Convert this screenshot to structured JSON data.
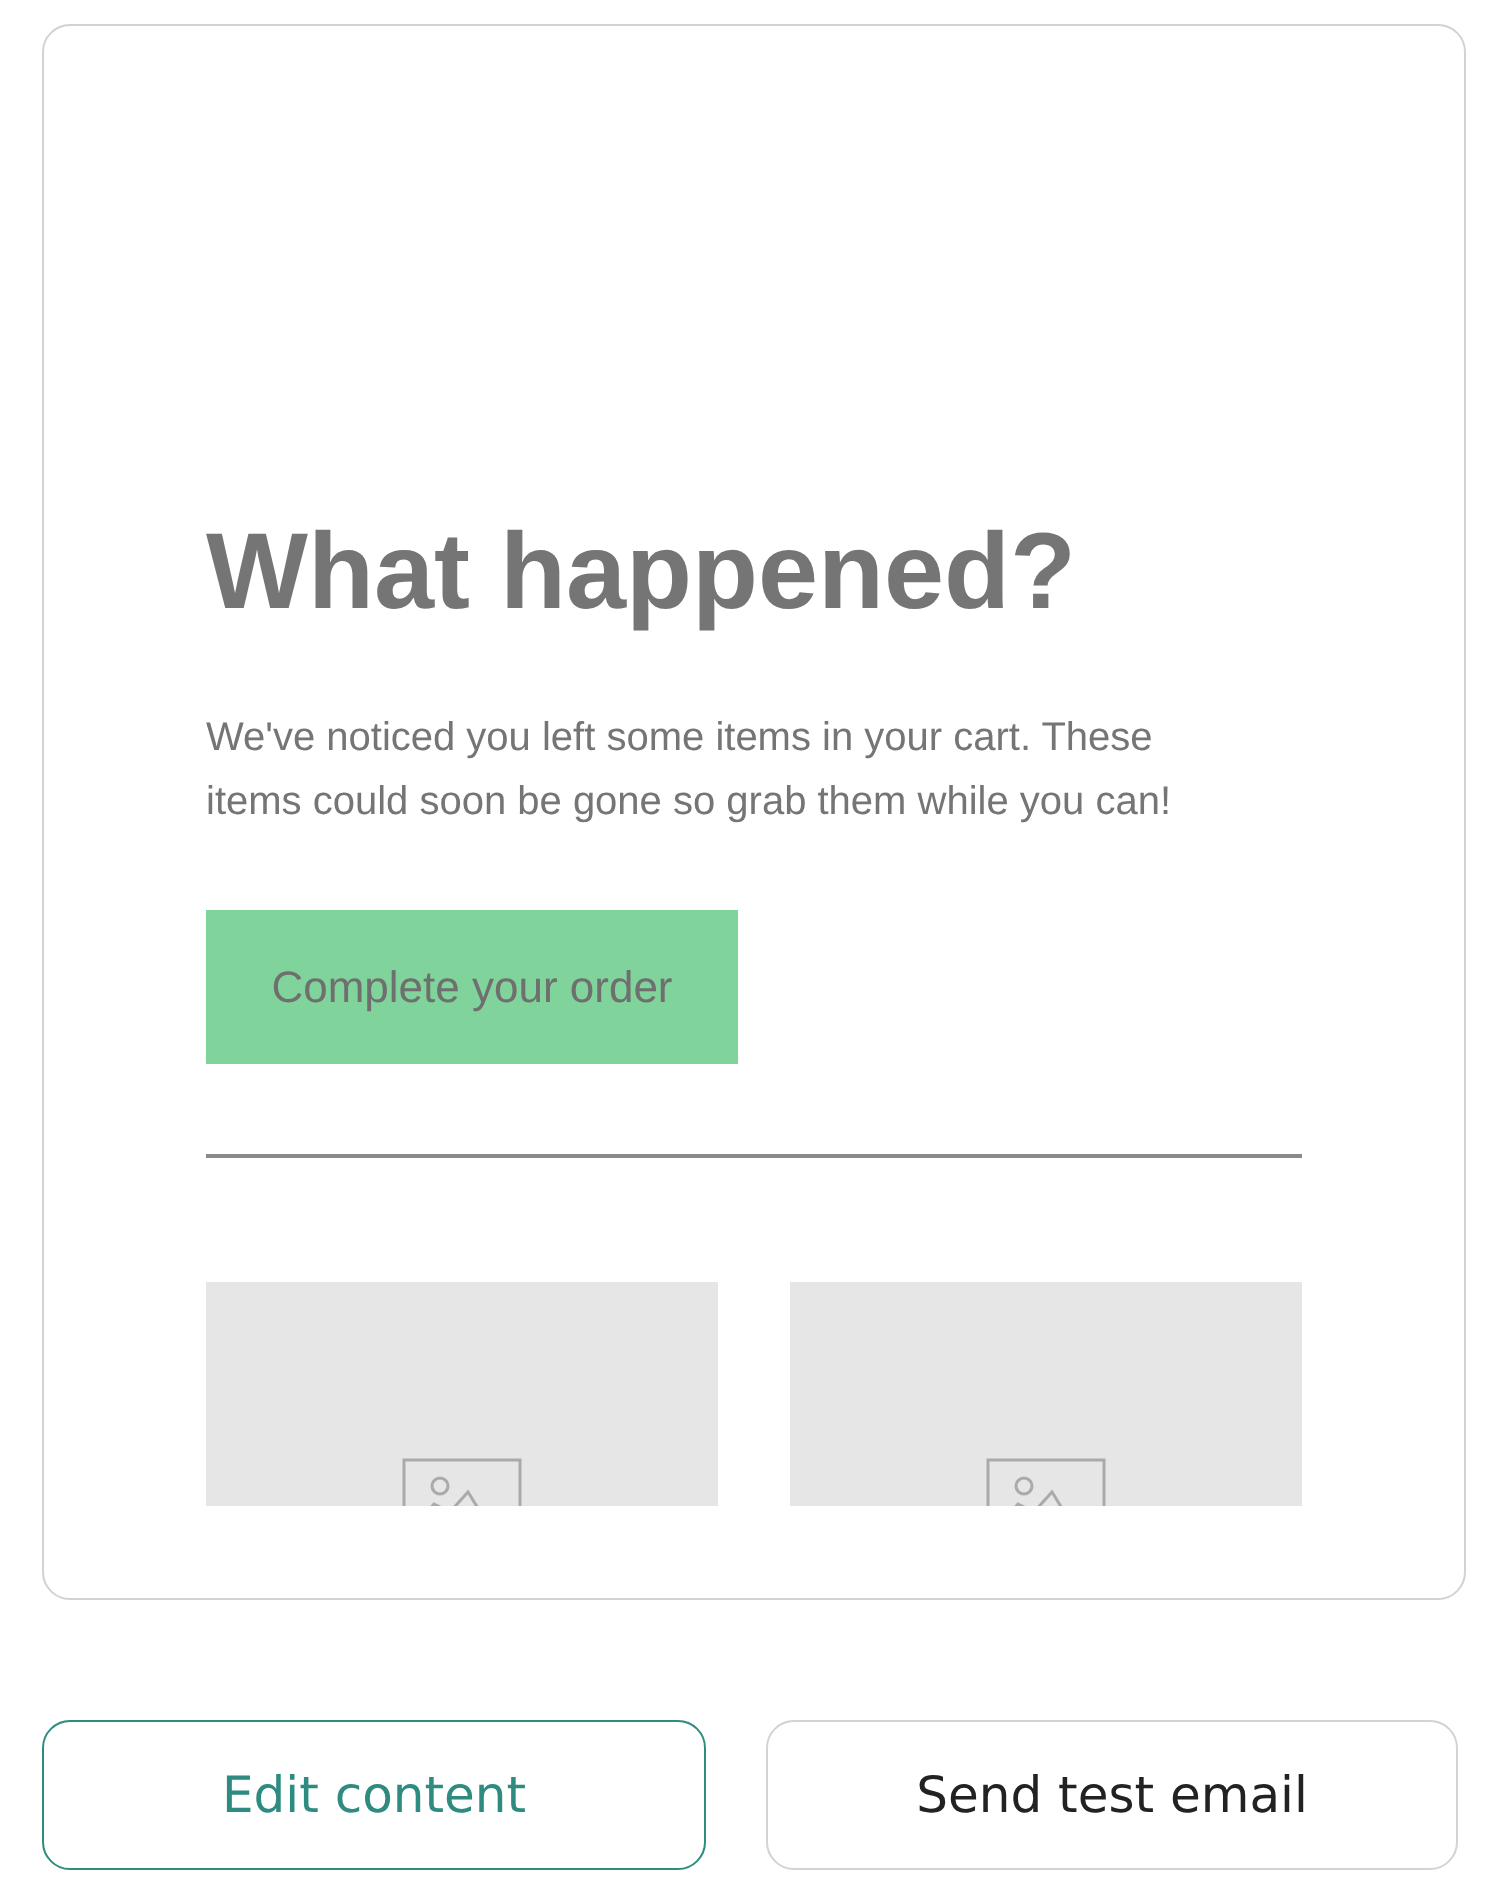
{
  "preview": {
    "heading": "What happened?",
    "body": "We've noticed you left some items in your cart. These items could soon be gone so grab them while you can!",
    "cta": "Complete your order"
  },
  "buttons": [
    {
      "label": "Edit content",
      "kind": "primary"
    },
    {
      "label": "Send test email",
      "kind": "secondary"
    }
  ]
}
